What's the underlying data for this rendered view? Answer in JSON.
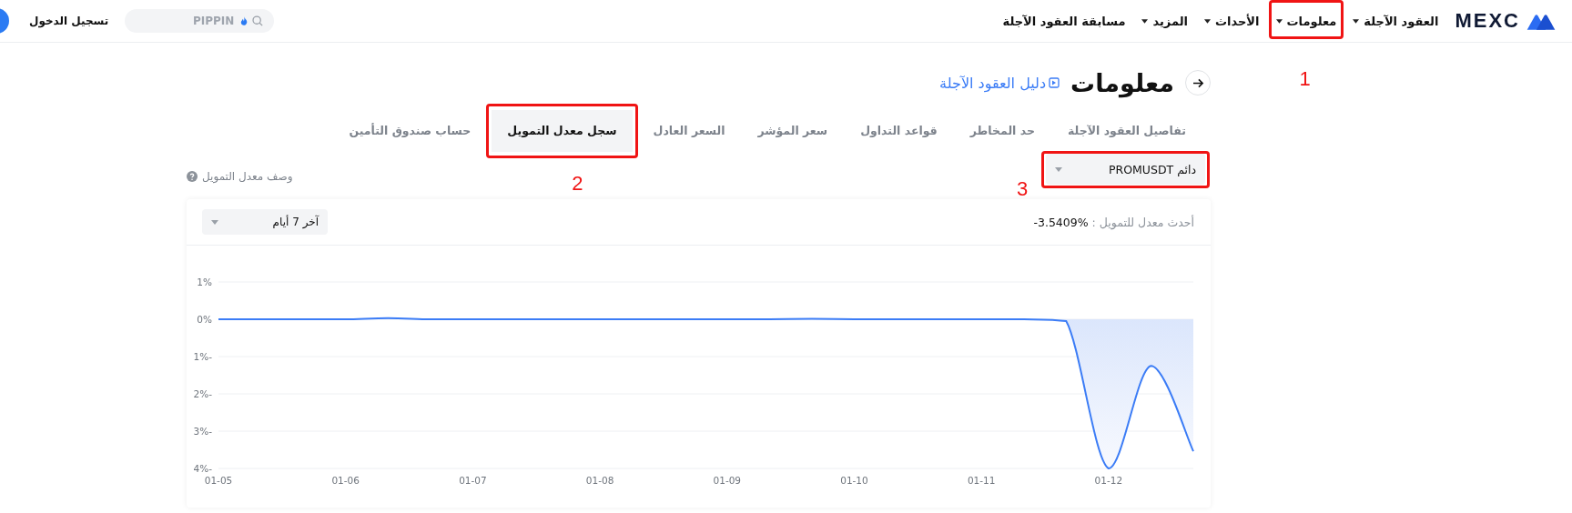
{
  "header": {
    "logo": "MEXC",
    "nav": [
      {
        "label": "العقود الآجلة",
        "caret": true
      },
      {
        "label": "معلومات",
        "caret": true,
        "annotation": "1"
      },
      {
        "label": "الأحداث",
        "caret": true
      },
      {
        "label": "المزيد",
        "caret": true
      },
      {
        "label": "مسابقة العقود الآجلة",
        "caret": false
      }
    ],
    "search": {
      "placeholder": "PIPPIN"
    },
    "login": "تسجيل الدخول"
  },
  "page": {
    "title": "معلومات",
    "guide_link": "دليل العقود الآجلة"
  },
  "tabs": [
    {
      "label": "تفاصيل العقود الآجلة",
      "selected": false
    },
    {
      "label": "حد المخاطر",
      "selected": false
    },
    {
      "label": "قواعد التداول",
      "selected": false
    },
    {
      "label": "سعر المؤشر",
      "selected": false
    },
    {
      "label": "السعر العادل",
      "selected": false
    },
    {
      "label": "سجل معدل التمويل",
      "selected": true,
      "annotation": "2"
    },
    {
      "label": "حساب صندوق التأمين",
      "selected": false
    }
  ],
  "contract_select": {
    "value": "دائم PROMUSDT",
    "annotation": "3"
  },
  "funding_info_link": "وصف معدل التمويل",
  "chart_card": {
    "latest_label": "أحدث معدل للتمويل :",
    "latest_value": "%3.5409-",
    "period": "آخر 7 أيام",
    "chart_data": {
      "type": "area",
      "categories": [
        "01-05",
        null,
        null,
        "01-06",
        null,
        null,
        "01-07",
        null,
        null,
        "01-08",
        null,
        null,
        "01-09",
        null,
        null,
        "01-10",
        null,
        null,
        "01-11",
        null,
        null,
        "01-12",
        null,
        null
      ],
      "series": [
        {
          "color": "#3b7cf6",
          "values": [
            0,
            0,
            0,
            0,
            0.03,
            0,
            0,
            0,
            0,
            0,
            0,
            0,
            0,
            0,
            0.01,
            0,
            0,
            0,
            0,
            0,
            -0.05,
            -4.0,
            -1.25,
            -3.54
          ]
        }
      ],
      "ylim": [
        -4,
        1
      ],
      "grid": true,
      "yticks": [
        {
          "value": 1,
          "label": "1%"
        },
        {
          "value": 0,
          "label": "0%"
        },
        {
          "value": -1,
          "label": "1%-"
        },
        {
          "value": -2,
          "label": "2%-"
        },
        {
          "value": -3,
          "label": "3%-"
        },
        {
          "value": -4,
          "label": "4%-"
        }
      ]
    }
  }
}
